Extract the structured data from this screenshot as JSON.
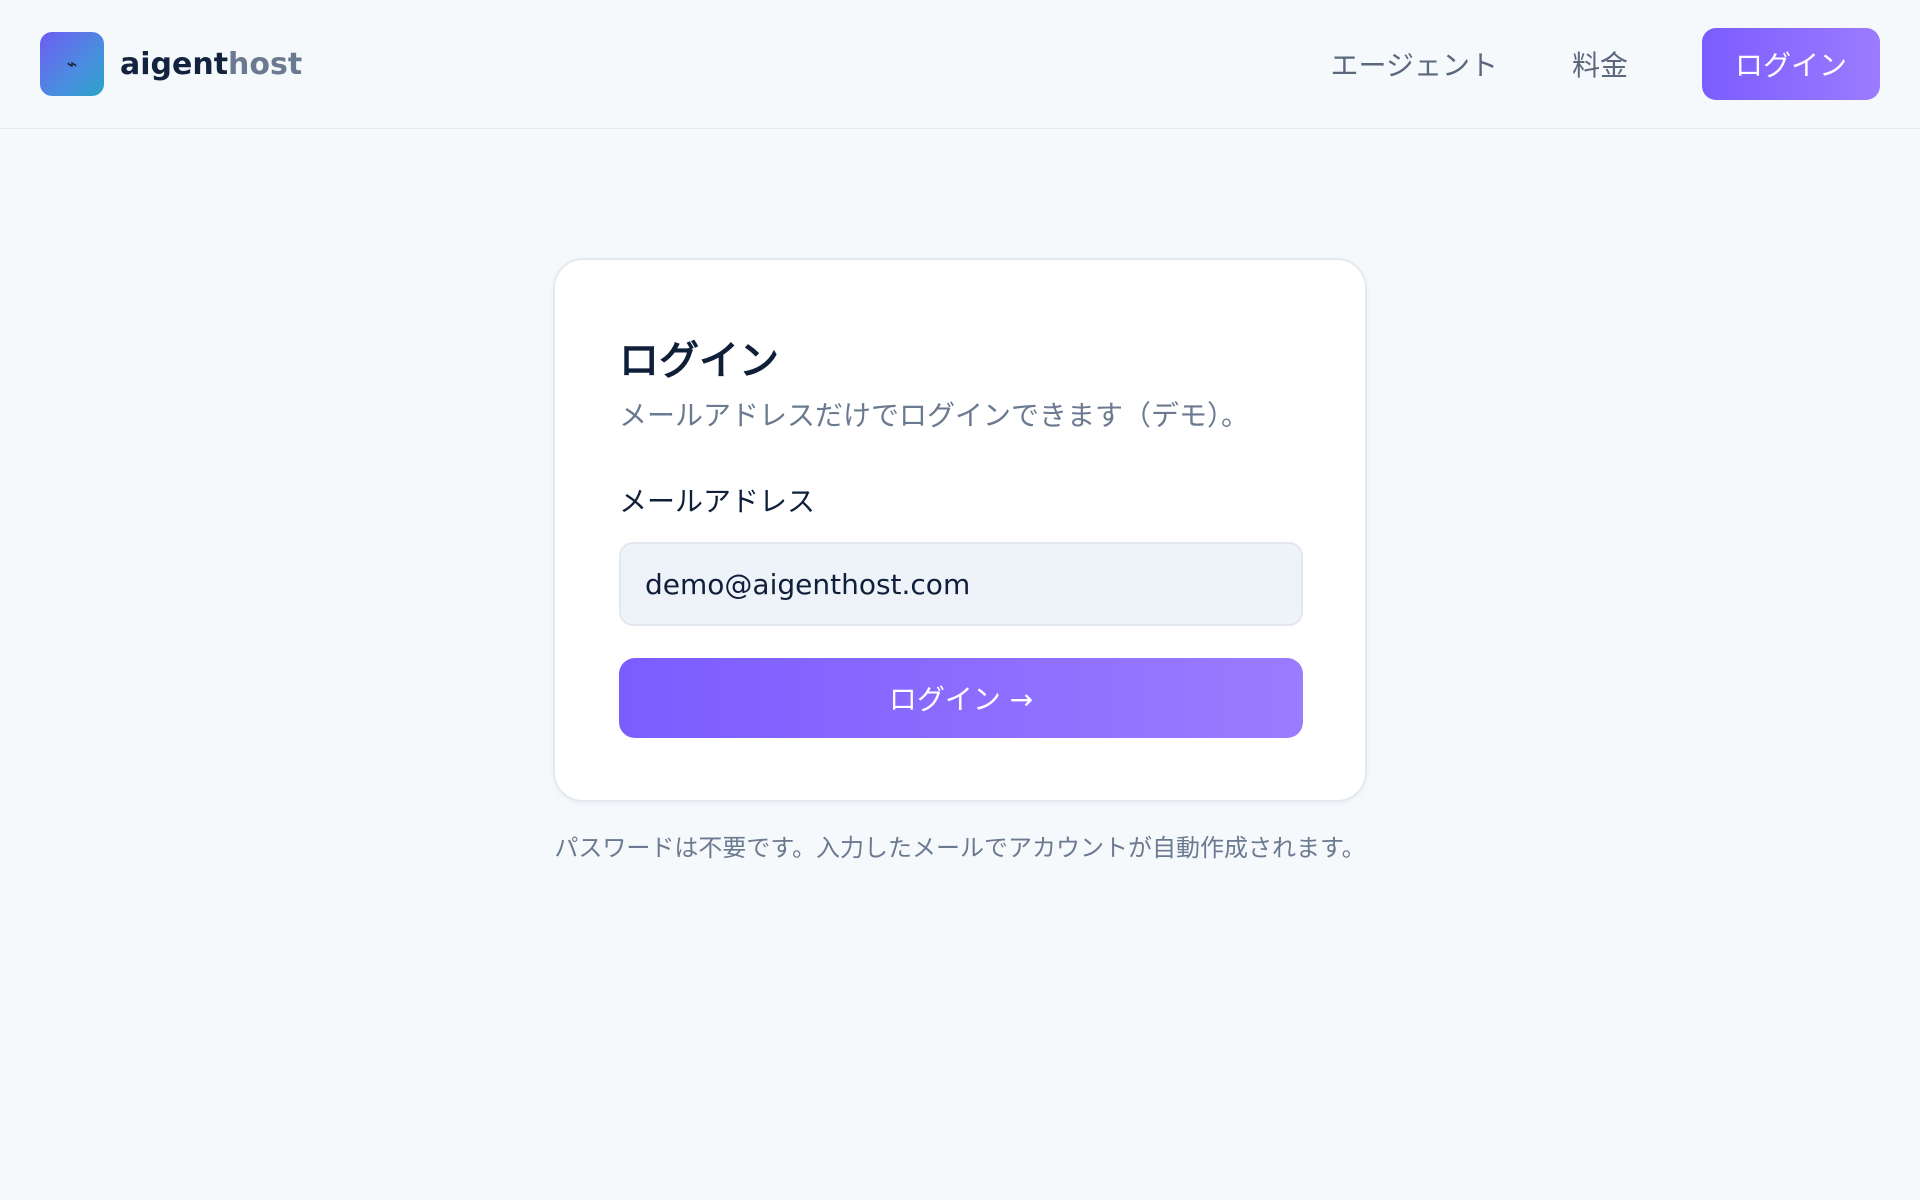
{
  "header": {
    "brand_primary": "aigent",
    "brand_secondary": "host",
    "logo_glyph": "⌁",
    "nav": {
      "agents_label": "エージェント",
      "pricing_label": "料金",
      "login_label": "ログイン"
    }
  },
  "login_card": {
    "title": "ログイン",
    "subtitle": "メールアドレスだけでログインできます（デモ）。",
    "email_label": "メールアドレス",
    "email_value": "demo@aigenthost.com",
    "submit_label": "ログイン →"
  },
  "footnote": "パスワードは不要です。入力したメールでアカウントが自動作成されます。",
  "colors": {
    "background": "#f5f9fc",
    "accent_start": "#7b5cff",
    "accent_end": "#9b7cff",
    "text_primary": "#0f1f3a",
    "text_muted": "#6b7a90"
  },
  "icons": {
    "logo": "aigenthost-logo-icon"
  }
}
